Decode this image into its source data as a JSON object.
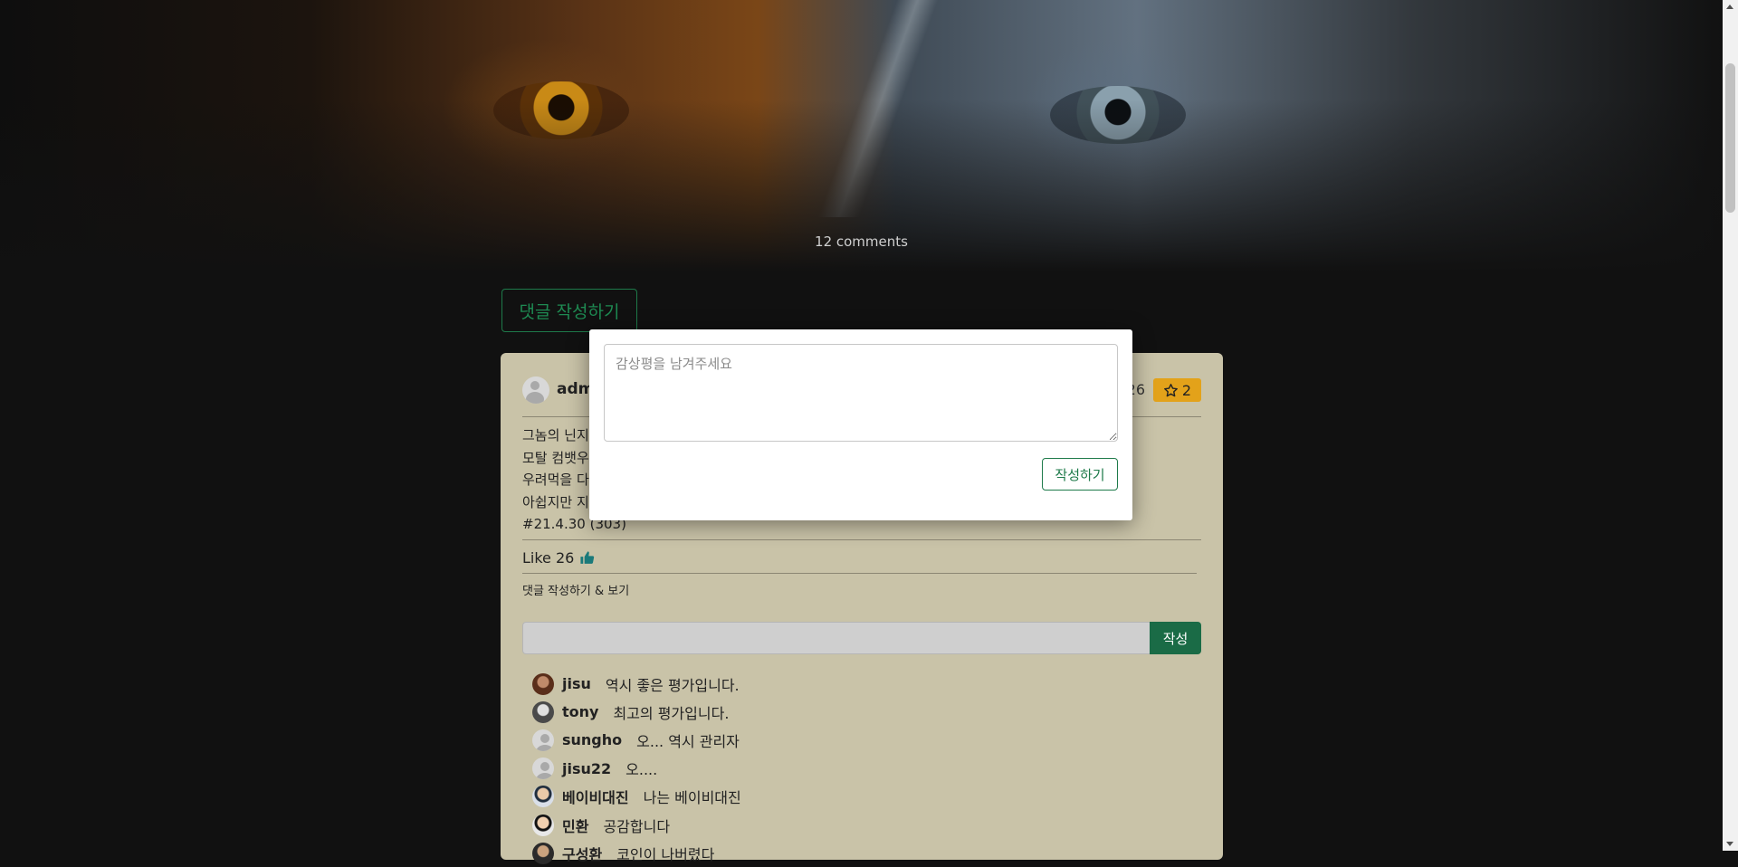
{
  "hero": {
    "comment_count": "12 comments"
  },
  "write_comment_button": "댓글 작성하기",
  "review_card": {
    "author": "adm",
    "header_number": "26",
    "star_count": "2",
    "review_lines": [
      "그놈의 닌지",
      "모탈 컴뱃우",
      "우려먹을 다",
      "아쉽지만 지",
      "#21.4.30 (303)"
    ],
    "like_label": "Like 26",
    "comment_section_label": "댓글 작성하기 & 보기",
    "comment_input_value": "",
    "comment_submit": "작성"
  },
  "comments": [
    {
      "user": "jisu",
      "text": "역시 좋은 평가입니다.",
      "avatar": "photo"
    },
    {
      "user": "tony",
      "text": "최고의 평가입니다.",
      "avatar": "photo"
    },
    {
      "user": "sungho",
      "text": "오... 역시 관리자",
      "avatar": "default"
    },
    {
      "user": "jisu22",
      "text": "오....",
      "avatar": "default"
    },
    {
      "user": "베이비대진",
      "text": "나는 베이비대진",
      "avatar": "photo"
    },
    {
      "user": "민환",
      "text": "공감합니다",
      "avatar": "photo"
    },
    {
      "user": "구성환",
      "text": "코인이 나버렸다",
      "avatar": "photo"
    }
  ],
  "modal": {
    "textarea_placeholder": "감상평을 남겨주세요",
    "submit_label": "작성하기"
  },
  "colors": {
    "card_bg": "#c9c3a8",
    "accent_green": "#1a6b46",
    "star_badge": "#e3a21a"
  }
}
